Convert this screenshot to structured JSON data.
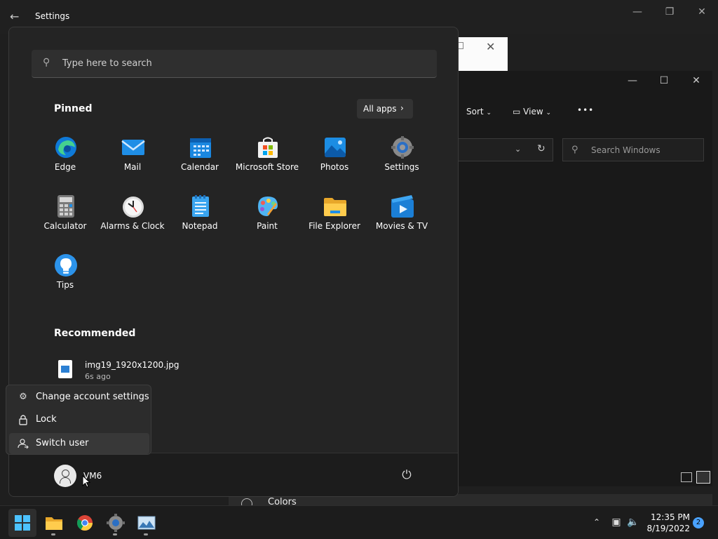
{
  "settings": {
    "title": "Settings",
    "colors_label": "Colors"
  },
  "explorer": {
    "sort_label": "Sort",
    "view_label": "View",
    "more_label": "•••",
    "search_placeholder": "Search Windows"
  },
  "start_menu": {
    "search_placeholder": "Type here to search",
    "pinned_title": "Pinned",
    "all_apps_label": "All apps",
    "pinned": [
      {
        "name": "Edge",
        "icon": "edge-icon"
      },
      {
        "name": "Mail",
        "icon": "mail-icon"
      },
      {
        "name": "Calendar",
        "icon": "calendar-icon"
      },
      {
        "name": "Microsoft Store",
        "icon": "store-icon"
      },
      {
        "name": "Photos",
        "icon": "photos-icon"
      },
      {
        "name": "Settings",
        "icon": "gear-icon"
      },
      {
        "name": "Calculator",
        "icon": "calculator-icon"
      },
      {
        "name": "Alarms & Clock",
        "icon": "clock-icon"
      },
      {
        "name": "Notepad",
        "icon": "notepad-icon"
      },
      {
        "name": "Paint",
        "icon": "paint-icon"
      },
      {
        "name": "File Explorer",
        "icon": "folder-icon"
      },
      {
        "name": "Movies & TV",
        "icon": "movies-icon"
      },
      {
        "name": "Tips",
        "icon": "lightbulb-icon"
      }
    ],
    "recommended_title": "Recommended",
    "recommended": [
      {
        "name": "img19_1920x1200.jpg",
        "time": "6s ago"
      }
    ],
    "user_name": "VM6"
  },
  "account_flyout": {
    "items": [
      {
        "label": "Change account settings",
        "icon": "gear-user-icon"
      },
      {
        "label": "Lock",
        "icon": "lock-icon"
      },
      {
        "label": "Switch user",
        "icon": "switch-user-icon"
      }
    ]
  },
  "taskbar": {
    "time": "12:35 PM",
    "date": "8/19/2022",
    "notification_count": "2"
  },
  "colors": {
    "accent": "#4aa2ff",
    "start_bg": "#242424",
    "taskbar_bg": "#1c1c1c"
  }
}
